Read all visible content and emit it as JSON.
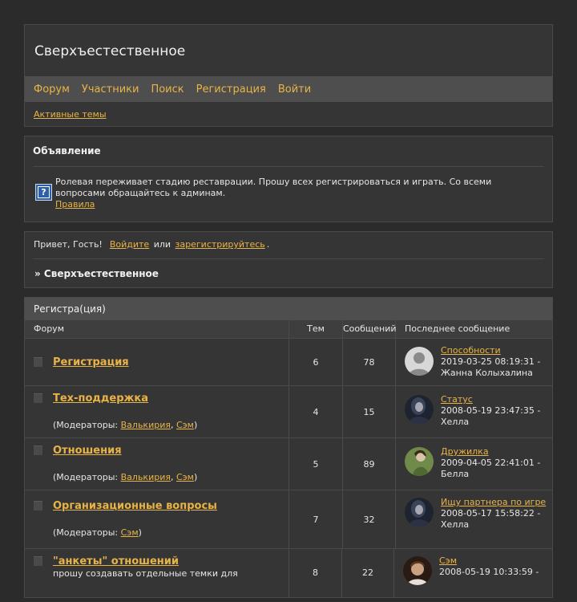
{
  "site": {
    "title": "Сверхъестественное"
  },
  "nav": [
    {
      "label": "Форум"
    },
    {
      "label": "Участники"
    },
    {
      "label": "Поиск"
    },
    {
      "label": "Регистрация"
    },
    {
      "label": "Войти"
    }
  ],
  "subnav": {
    "active_topics": "Активные темы"
  },
  "announcement": {
    "title": "Объявление",
    "text": "Ролевая переживает стадию реставрации. Прошу всех регистрироваться и играть. Со всеми вопросами обращайтесь к админам.",
    "link": "Правила"
  },
  "welcome": {
    "greeting": "Привет, Гость!",
    "login": "Войдите",
    "or": "или",
    "register": "зарегистрируйтесь",
    "period": ".",
    "crumb": "» Сверхъестественное"
  },
  "category": {
    "title": "Регистра(ция)",
    "headers": {
      "forum": "Форум",
      "topics": "Тем",
      "messages": "Сообщений",
      "last": "Последнее сообщение"
    }
  },
  "forums": [
    {
      "name": "Регистрация",
      "topics": "6",
      "messages": "78",
      "last_topic": "Способности",
      "last_date": "2019-03-25 08:19:31 -",
      "last_user": "Жанна Колыхалина",
      "avatar": "default"
    },
    {
      "name": "Тех-поддержка",
      "mods_prefix": "(Модераторы: ",
      "mod1": "Валькирия",
      "sep": ", ",
      "mod2": "Сэм",
      "mods_suffix": ")",
      "topics": "4",
      "messages": "15",
      "last_topic": "Статус",
      "last_date": "2008-05-19 23:47:35 -",
      "last_user": "Хелла",
      "avatar": "dark"
    },
    {
      "name": "Отношения",
      "mods_prefix": "(Модераторы: ",
      "mod1": "Валькирия",
      "sep": ", ",
      "mod2": "Сэм",
      "mods_suffix": ")",
      "topics": "5",
      "messages": "89",
      "last_topic": "Дружилка",
      "last_date": "2009-04-05 22:41:01 -",
      "last_user": "Белла",
      "avatar": "green"
    },
    {
      "name": "Организационные вопросы",
      "mods_prefix": "(Модераторы: ",
      "mod1": "Сэм",
      "mods_suffix": ")",
      "topics": "7",
      "messages": "32",
      "last_topic": "Ищу партнера по игре",
      "last_date": "2008-05-17 15:58:22 -",
      "last_user": "Хелла",
      "avatar": "dark"
    },
    {
      "name": "\"анкеты\" отношений",
      "desc": "прошу создавать отдельные темки для",
      "topics": "8",
      "messages": "22",
      "last_topic": "Сэм",
      "last_date": "2008-05-19 10:33:59 -",
      "avatar": "warm"
    }
  ]
}
